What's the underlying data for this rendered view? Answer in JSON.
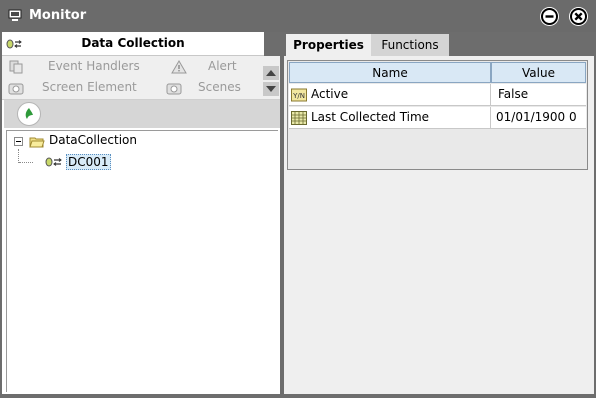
{
  "window": {
    "title": "Monitor"
  },
  "left_panel": {
    "tab_label": "Data Collection",
    "toolbox": {
      "event_handlers": "Event Handlers",
      "alert": "Alert",
      "screen_element": "Screen Element",
      "scenes": "Scenes"
    },
    "tree": {
      "root_label": "DataCollection",
      "child_label": "DC001"
    }
  },
  "right_panel": {
    "tabs": [
      {
        "label": "Properties"
      },
      {
        "label": "Functions"
      }
    ],
    "grid": {
      "columns": [
        "Name",
        "Value"
      ],
      "rows": [
        {
          "name": "Active",
          "value": "False",
          "icon": "boolean-icon"
        },
        {
          "name": "Last Collected Time",
          "value": "01/01/1900 0",
          "icon": "datetime-icon"
        }
      ]
    }
  },
  "colors": {
    "frame": "#6d6d6d",
    "header_blue": "#d9e8f5",
    "selected_node": "#d8ebf8"
  }
}
